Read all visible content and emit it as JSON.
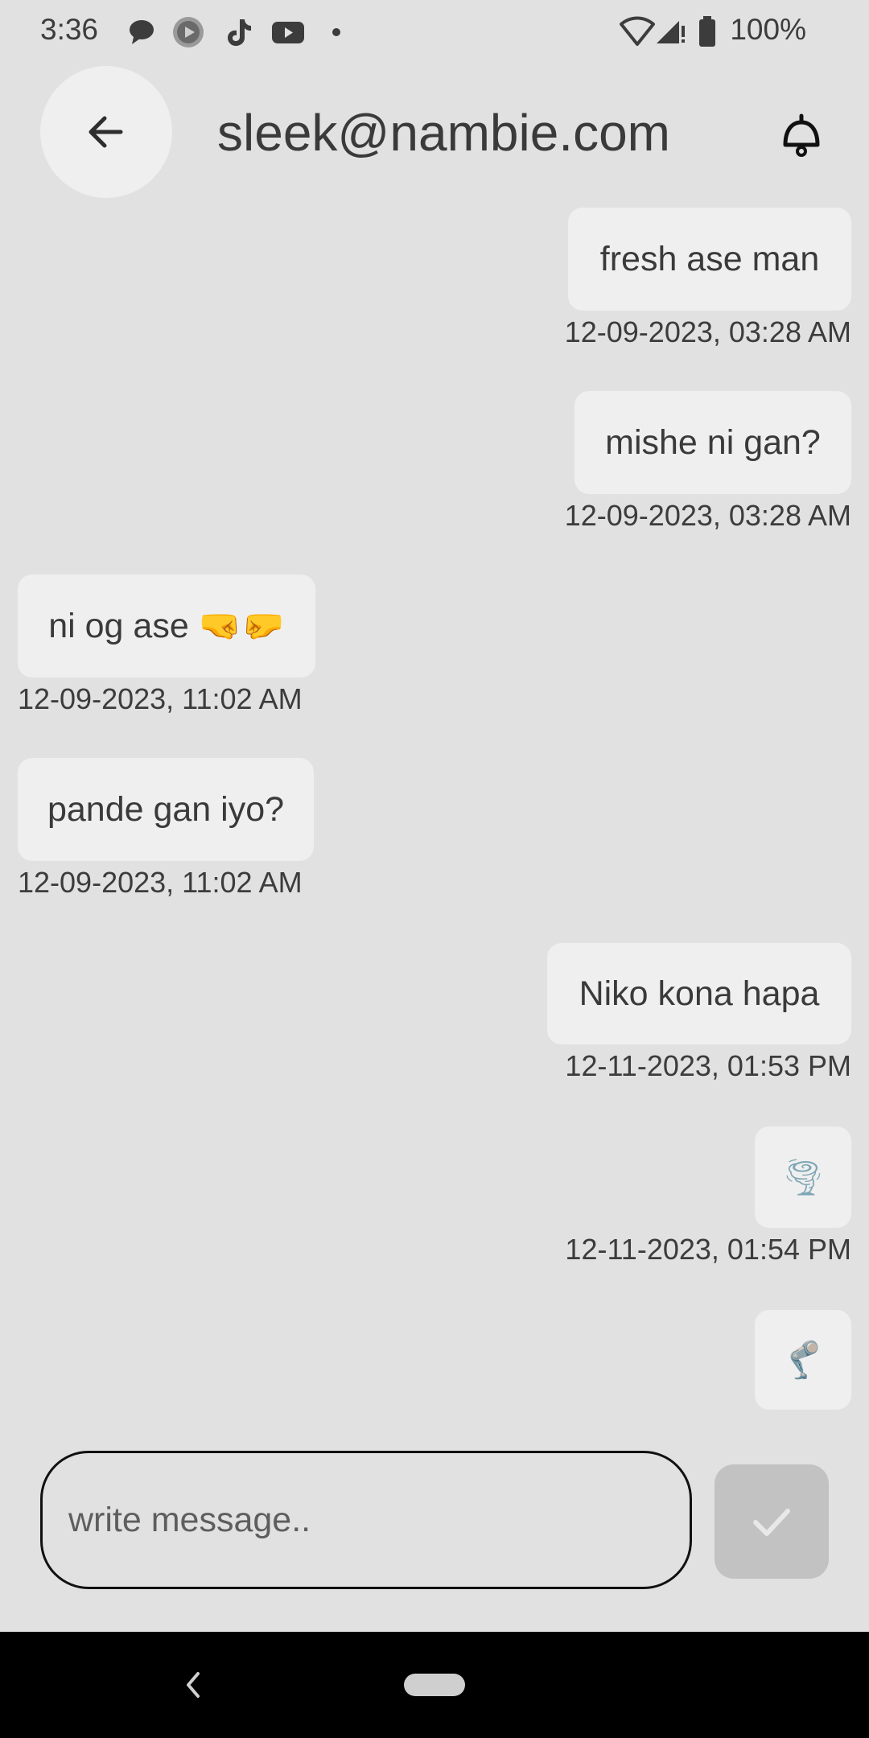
{
  "status_bar": {
    "time": "3:36",
    "battery": "100%",
    "icons": [
      "messages-icon",
      "play-icon",
      "tiktok-icon",
      "youtube-icon",
      "dot-icon",
      "wifi-icon",
      "signal-icon",
      "battery-icon"
    ]
  },
  "header": {
    "title": "sleek@nambie.com",
    "back_icon": "arrow-left-icon",
    "notify_icon": "bell-icon"
  },
  "messages": [
    {
      "side": "right",
      "text": "fresh ase man",
      "time": "12-09-2023, 03:28 AM"
    },
    {
      "side": "right",
      "text": "mishe ni gan?",
      "time": "12-09-2023, 03:28 AM"
    },
    {
      "side": "left",
      "text": "ni og ase 🤜🤛",
      "time": "12-09-2023, 11:02 AM"
    },
    {
      "side": "left",
      "text": "pande gan iyo?",
      "time": "12-09-2023, 11:02 AM"
    },
    {
      "side": "right",
      "text": "Niko kona hapa",
      "time": "12-11-2023, 01:53 PM"
    },
    {
      "side": "right",
      "text": "🌪",
      "time": "12-11-2023, 01:54 PM"
    },
    {
      "side": "right",
      "text": "🦿",
      "time": ""
    }
  ],
  "composer": {
    "placeholder": "write message..",
    "value": "",
    "send_icon": "check-icon"
  },
  "colors": {
    "background": "#e1e1e1",
    "bubble": "#efefef",
    "send_button": "#c2c2c2"
  }
}
